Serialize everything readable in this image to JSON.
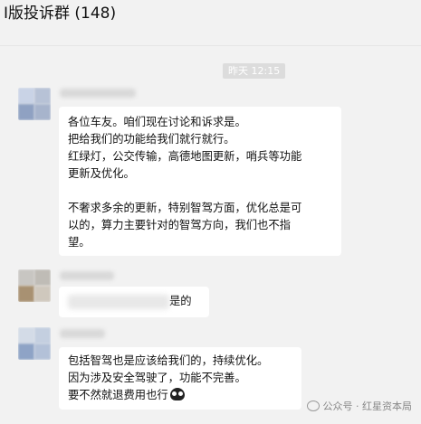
{
  "window": {
    "title": "I版投诉群 (148)"
  },
  "chat": {
    "timestamp": "昨天 12:15",
    "messages": [
      {
        "lines": [
          "各位车友。咱们现在讨论和诉求是。",
          "把给我们的功能给我们就行就行。",
          "红绿灯，公交传输，高德地图更新，哨兵等功能",
          "更新及优化。",
          "",
          "不奢求多余的更新，特别智驾方面，优化总是可",
          "以的，算力主要针对的智驾方向，我们也不指",
          "望。"
        ]
      },
      {
        "suffix": "是的"
      },
      {
        "lines": [
          "包括智驾也是应该给我们的，持续优化。",
          "因为涉及安全驾驶了，功能不完善。",
          "要不然就退费用也行"
        ]
      }
    ]
  },
  "watermark": {
    "text": "公众号 · 红星资本局",
    "icon": "wechat-icon"
  }
}
